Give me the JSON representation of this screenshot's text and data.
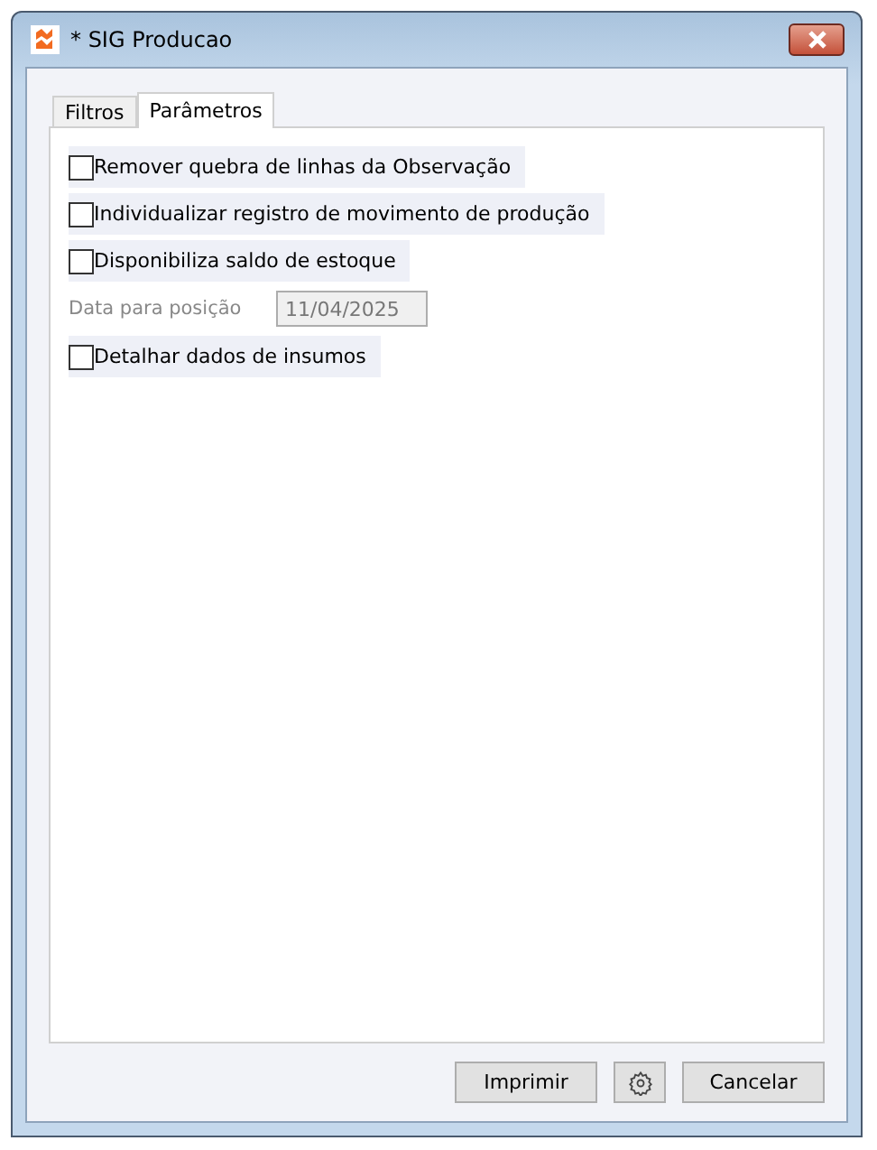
{
  "window": {
    "title": "* SIG Producao"
  },
  "tabs": [
    {
      "label": "Filtros",
      "selected": false
    },
    {
      "label": "Parâmetros",
      "selected": true
    }
  ],
  "options": [
    {
      "kind": "checkbox",
      "label": "Remover quebra de linhas da Observação",
      "checked": false
    },
    {
      "kind": "checkbox",
      "label": "Individualizar registro de movimento de produção",
      "checked": false
    },
    {
      "kind": "checkbox",
      "label": "Disponibiliza saldo de estoque",
      "checked": false
    },
    {
      "kind": "field",
      "label": "Data para posição",
      "value": "11/04/2025",
      "disabled": true
    },
    {
      "kind": "checkbox",
      "label": "Detalhar dados de insumos",
      "checked": false
    }
  ],
  "buttons": [
    {
      "kind": "text",
      "label": "Imprimir"
    },
    {
      "kind": "gear"
    },
    {
      "kind": "text",
      "label": "Cancelar"
    }
  ]
}
